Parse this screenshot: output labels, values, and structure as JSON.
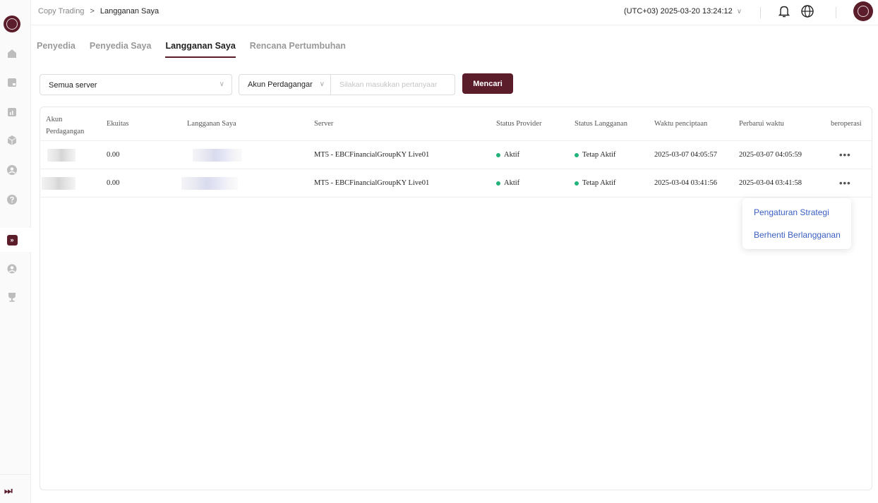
{
  "breadcrumb": {
    "root": "Copy Trading",
    "separator": ">",
    "current": "Langganan Saya"
  },
  "header": {
    "timezone": "(UTC+03)  2025-03-20 13:24:12",
    "timezone_chevron": "∨"
  },
  "tabs": [
    {
      "label": "Penyedia",
      "active": false
    },
    {
      "label": "Penyedia Saya",
      "active": false
    },
    {
      "label": "Langganan Saya",
      "active": true
    },
    {
      "label": "Rencana Pertumbuhan",
      "active": false
    }
  ],
  "filters": {
    "server_value": "Semua server",
    "account_type": "Akun Perdagangar",
    "search_placeholder": "Silakan masukkan pertanyaar",
    "search_button": "Mencari",
    "chevron": "∨"
  },
  "table": {
    "columns": [
      "Akun Perdagangan",
      "Ekuitas",
      "Langganan Saya",
      "Server",
      "Status Provider",
      "Status Langganan",
      "Waktu penciptaan",
      "Perbarui waktu",
      "beroperasi"
    ],
    "rows": [
      {
        "equity": "0.00",
        "server": "MT5 - EBCFinancialGroupKY Live01",
        "provider_status": "Aktif",
        "subscription_status": "Tetap Aktif",
        "created": "2025-03-07 04:05:57",
        "updated": "2025-03-07 04:05:59",
        "ops": "•••"
      },
      {
        "equity": "0.00",
        "server": "MT5 - EBCFinancialGroupKY Live01",
        "provider_status": "Aktif",
        "subscription_status": "Tetap Aktif",
        "created": "2025-03-04 03:41:56",
        "updated": "2025-03-04 03:41:58",
        "ops": "•••"
      }
    ]
  },
  "menu": {
    "items": [
      "Pengaturan Strategi",
      "Berhenti Berlangganan"
    ]
  },
  "sidebar": {
    "collapse_glyph": "⏭",
    "active_glyph": "»"
  },
  "colors": {
    "brand": "#5c1d2b",
    "status_green": "#21b27a",
    "link_blue": "#3b5fc2"
  }
}
